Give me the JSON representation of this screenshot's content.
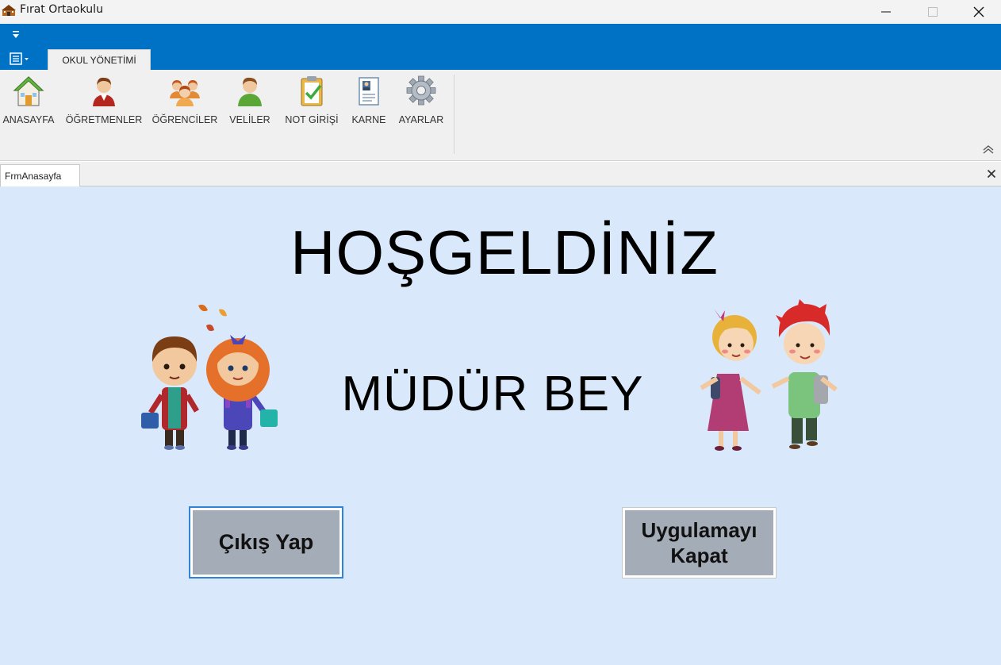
{
  "window": {
    "title": "Fırat Ortaokulu",
    "minimize_glyph": "—",
    "close_glyph": "✕"
  },
  "ribbon": {
    "tab_label": "OKUL YÖNETİMİ",
    "items": [
      {
        "label": "ANASAYFA",
        "icon": "house-icon"
      },
      {
        "label": "ÖĞRETMENLER",
        "icon": "teacher-icon"
      },
      {
        "label": "ÖĞRENCİLER",
        "icon": "students-icon"
      },
      {
        "label": "VELİLER",
        "icon": "parent-icon"
      },
      {
        "label": "NOT GİRİŞİ",
        "icon": "clipboard-check-icon"
      },
      {
        "label": "KARNE",
        "icon": "report-card-icon"
      },
      {
        "label": "AYARLAR",
        "icon": "gear-icon"
      }
    ]
  },
  "document": {
    "tab_label": "FrmAnasayfa"
  },
  "main": {
    "welcome": "HOŞGELDİNİZ",
    "subtitle": "MÜDÜR BEY",
    "exit_button": "Çıkış Yap",
    "close_app_line1": "Uygulamayı",
    "close_app_line2": "Kapat"
  },
  "colors": {
    "ribbon_blue": "#0072c6",
    "content_bg": "#d9e9fb",
    "button_gray": "#a3acb7",
    "focus_border": "#2f84d8"
  }
}
